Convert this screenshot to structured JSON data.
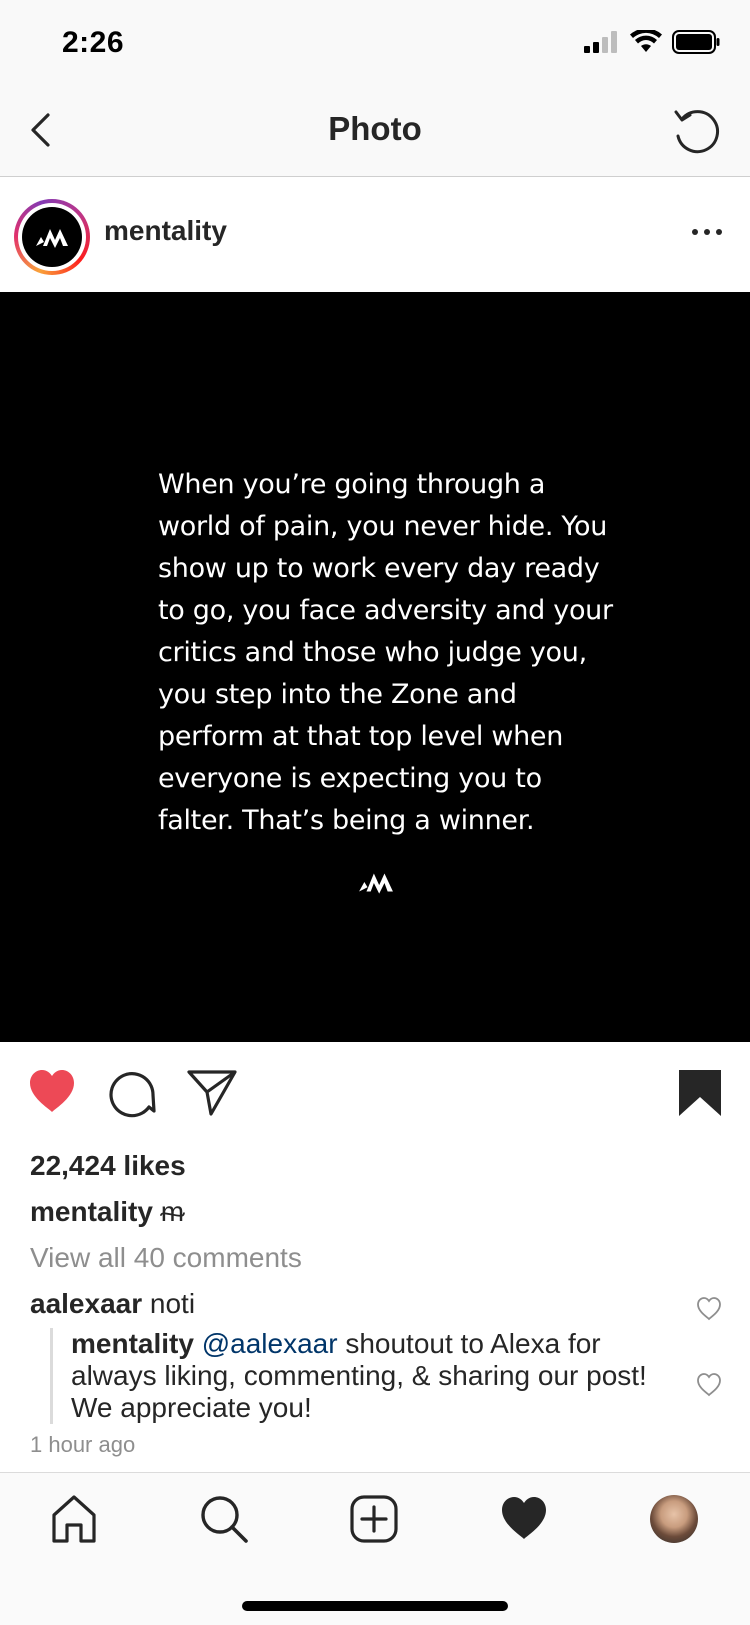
{
  "status_bar": {
    "time": "2:26"
  },
  "nav": {
    "title": "Photo"
  },
  "post": {
    "username": "mentality",
    "quote": "When you’re going through a world of pain, you never hide. You show up to work every day ready to go, you face adversity and your critics and those who judge you, you step into the Zone and perform at that top level when everyone is expecting you to falter. That’s being a winner."
  },
  "engagement": {
    "likes": "22,424 likes",
    "caption_user": "mentality",
    "caption_text": "ᵯ",
    "view_comments": "View all 40 comments",
    "comment": {
      "user": "aalexaar",
      "text": "noti"
    },
    "reply": {
      "user": "mentality",
      "mention": "@aalexaar",
      "text": "shoutout to Alexa for always liking, commenting, & sharing our post! We appreciate you!"
    },
    "timestamp": "1 hour ago"
  },
  "colors": {
    "like_active": "#ed4956",
    "text": "#262626",
    "muted": "#8e8e8e",
    "mention": "#003569"
  },
  "icons": {
    "back": "chevron-left-icon",
    "refresh": "refresh-icon",
    "more": "more-icon",
    "like": "heart-icon",
    "comment": "comment-icon",
    "share": "send-icon",
    "save": "bookmark-icon",
    "home": "home-icon",
    "search": "search-icon",
    "new_post": "add-post-icon",
    "activity": "heart-icon"
  }
}
